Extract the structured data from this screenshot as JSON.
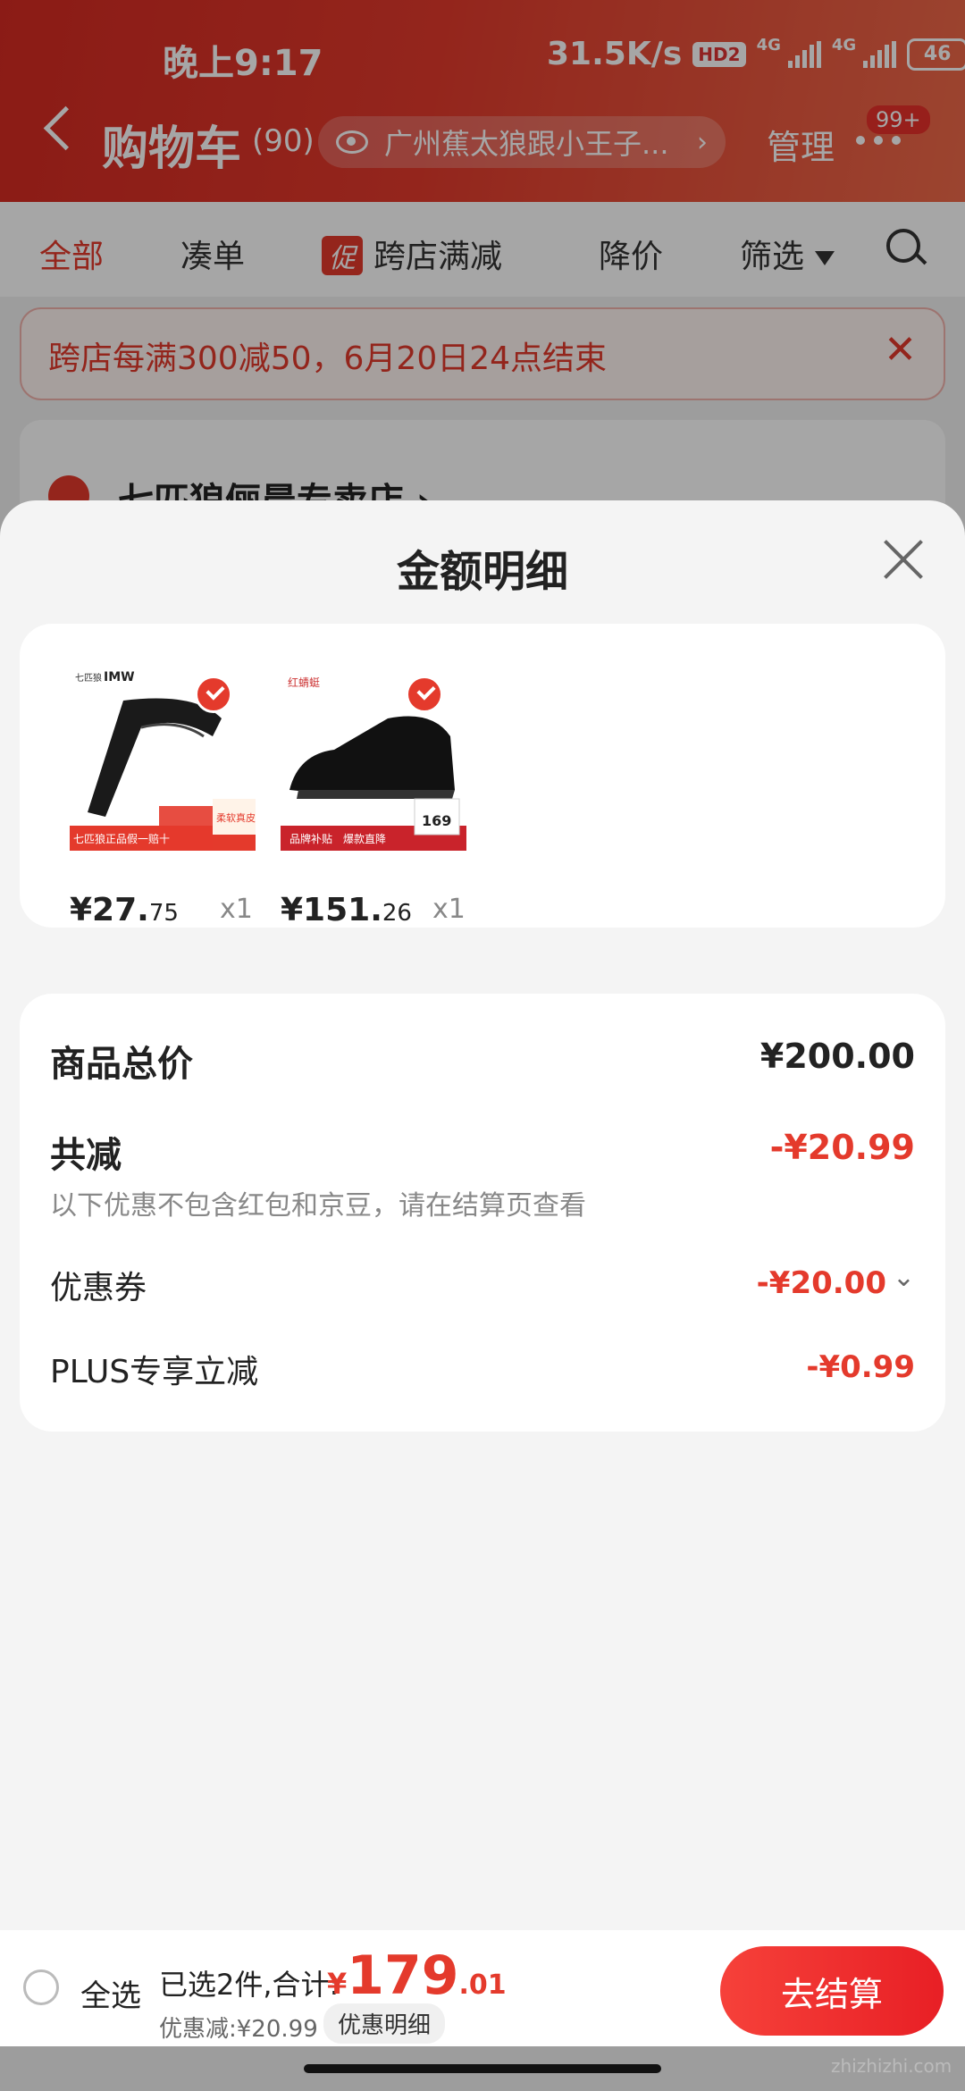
{
  "status": {
    "time": "晚上9:17",
    "net_speed": "31.5K/s",
    "hd": "HD2",
    "net1": "4G",
    "net2": "4G",
    "battery": "46"
  },
  "nav": {
    "title": "购物车",
    "count": "(90)",
    "location": "广州蕉太狼跟小王子...",
    "manage": "管理",
    "badge": "99+"
  },
  "tabs": {
    "all": "全部",
    "combine": "凑单",
    "promo_icon": "促",
    "cross_store": "跨店满减",
    "price_drop": "降价",
    "filter": "筛选"
  },
  "banner": {
    "text": "跨店每满300减50，6月20日24点结束"
  },
  "store": {
    "name": "七匹狼俪晨专卖店 ›"
  },
  "sheet": {
    "title": "金额明细",
    "products": [
      {
        "icon": "belt-product-image",
        "brand_text": "IMW",
        "tag1": "七匹狼正品",
        "tag2": "假一赔十",
        "tag3": "柔软真皮",
        "price_int": "¥27.",
        "price_dec": "75",
        "qty": "x1"
      },
      {
        "icon": "shoe-product-image",
        "brand_text": "红蜻蜓",
        "tag1": "品牌补贴",
        "tag2": "爆款直降",
        "tag3": "169",
        "price_int": "¥151.",
        "price_dec": "26",
        "qty": "x1"
      }
    ],
    "summary": {
      "total_label": "商品总价",
      "total_value": "¥200.00",
      "reduce_label": "共减",
      "reduce_value": "-¥20.99",
      "note": "以下优惠不包含红包和京豆，请在结算页查看",
      "coupon_label": "优惠券",
      "coupon_value": "-¥20.00",
      "plus_label": "PLUS专享立减",
      "plus_value": "-¥0.99"
    }
  },
  "bottom": {
    "select_all": "全选",
    "selected": "已选2件,合计:",
    "currency": "¥",
    "total_int": "179",
    "total_dec": ".01",
    "discount": "优惠减:¥20.99",
    "detail_button": "优惠明细",
    "checkout": "去结算"
  },
  "watermark": "zhizhizhi.com",
  "colors": {
    "accent": "#e43a2c",
    "header": "#d62a22"
  }
}
